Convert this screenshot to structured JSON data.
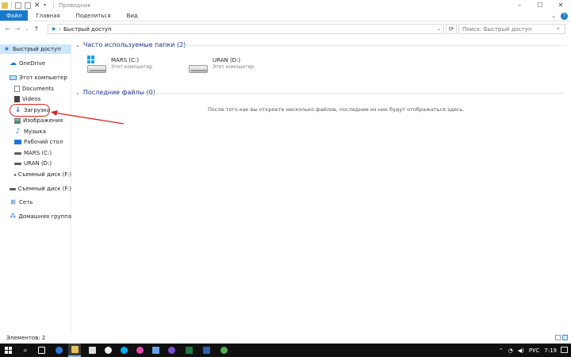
{
  "window": {
    "title": "Проводник",
    "controls": {
      "minimize": "–",
      "maximize": "☐",
      "close": "✕"
    }
  },
  "ribbon": {
    "tabs": [
      "Файл",
      "Главная",
      "Поделиться",
      "Вид"
    ],
    "expand": "⌄",
    "help": "?"
  },
  "nav": {
    "back": "←",
    "forward": "→",
    "recent": "⌄",
    "up": "↑"
  },
  "address": {
    "crumb_sep": "›",
    "location": "Быстрый доступ",
    "dropdown": "⌄",
    "refresh": "⟳"
  },
  "search": {
    "placeholder": "Поиск: Быстрый доступ",
    "icon": "search-icon"
  },
  "sidebar": {
    "items": [
      {
        "label": "Быстрый доступ",
        "icon": "star-icon"
      },
      {
        "label": "OneDrive",
        "icon": "cloud-icon"
      },
      {
        "label": "Этот компьютер",
        "icon": "computer-icon"
      },
      {
        "label": "Documents",
        "icon": "document-icon"
      },
      {
        "label": "Videos",
        "icon": "video-icon"
      },
      {
        "label": "Загрузки",
        "icon": "download-icon"
      },
      {
        "label": "Изображения",
        "icon": "pictures-icon"
      },
      {
        "label": "Музыка",
        "icon": "music-icon"
      },
      {
        "label": "Рабочий стол",
        "icon": "desktop-icon"
      },
      {
        "label": "MARS (C:)",
        "icon": "drive-icon"
      },
      {
        "label": "URAN (D:)",
        "icon": "drive-icon"
      },
      {
        "label": "Съемный диск (F:)",
        "icon": "removable-drive-icon"
      },
      {
        "label": "Съемный диск (F:)",
        "icon": "removable-drive-icon"
      },
      {
        "label": "Сеть",
        "icon": "network-icon"
      },
      {
        "label": "Домашняя группа",
        "icon": "homegroup-icon"
      }
    ]
  },
  "main": {
    "frequent": {
      "chevron": "⌄",
      "title": "Часто используемые папки (2)",
      "folders": [
        {
          "name": "MARS (C:)",
          "sub": "Этот компьютер"
        },
        {
          "name": "URAN (D:)",
          "sub": "Этот компьютер"
        }
      ]
    },
    "recent": {
      "chevron": "⌄",
      "title": "Последние файлы (0)",
      "empty_message": "После того как вы откроете несколько файлов, последние из них будут отображаться здесь."
    }
  },
  "status": {
    "items_count": "Элементов: 2"
  },
  "taskbar": {
    "search_glyph": "⌕",
    "language": "РУС",
    "time": "7:19",
    "tray_up": "⌃",
    "tray_speaker": "◀)",
    "tray_wifi": "◔"
  },
  "colors": {
    "accent": "#1979ca",
    "selection": "#cce8ff",
    "group_title": "#1e3287",
    "annotation": "#e02020"
  }
}
